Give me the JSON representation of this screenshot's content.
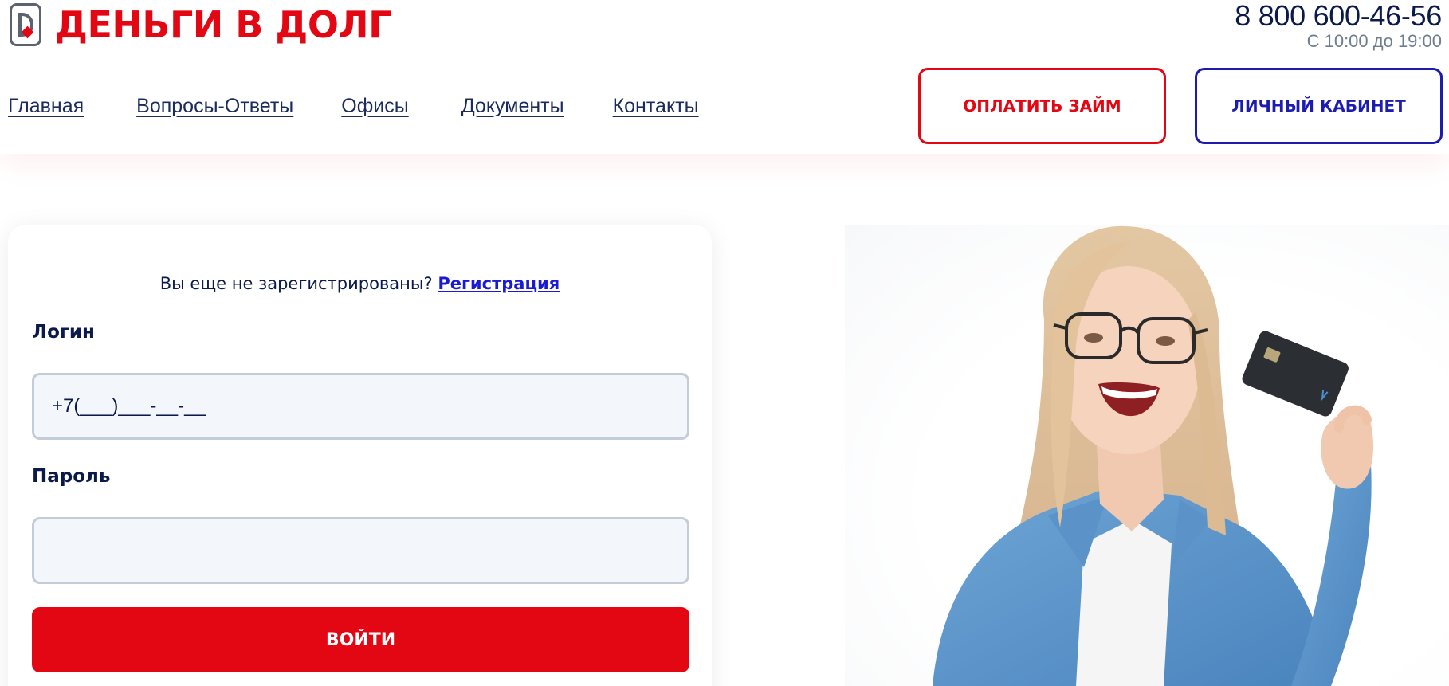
{
  "header": {
    "brand_name": "ДЕНЬГИ В ДОЛГ",
    "phone": "8 800 600-46-56",
    "hours": "С 10:00 до 19:00",
    "nav": [
      "Главная",
      "Вопросы-Ответы",
      "Офисы",
      "Документы",
      "Контакты"
    ],
    "pay_button": "ОПЛАТИТЬ ЗАЙМ",
    "cabinet_button": "ЛИЧНЫЙ КАБИНЕТ"
  },
  "login": {
    "not_registered": "Вы еще не зарегистрированы?",
    "register_link": "Регистрация",
    "login_label": "Логин",
    "login_value": "+7(___)___-__-__",
    "password_label": "Пароль",
    "password_value": "",
    "submit": "ВОЙТИ"
  },
  "colors": {
    "brand_red": "#e30613",
    "cabinet_blue": "#1c1cb0",
    "text_navy": "#0b1a4a",
    "input_bg": "#f3f6fb"
  },
  "icons": {
    "logo": "logo-icon"
  }
}
